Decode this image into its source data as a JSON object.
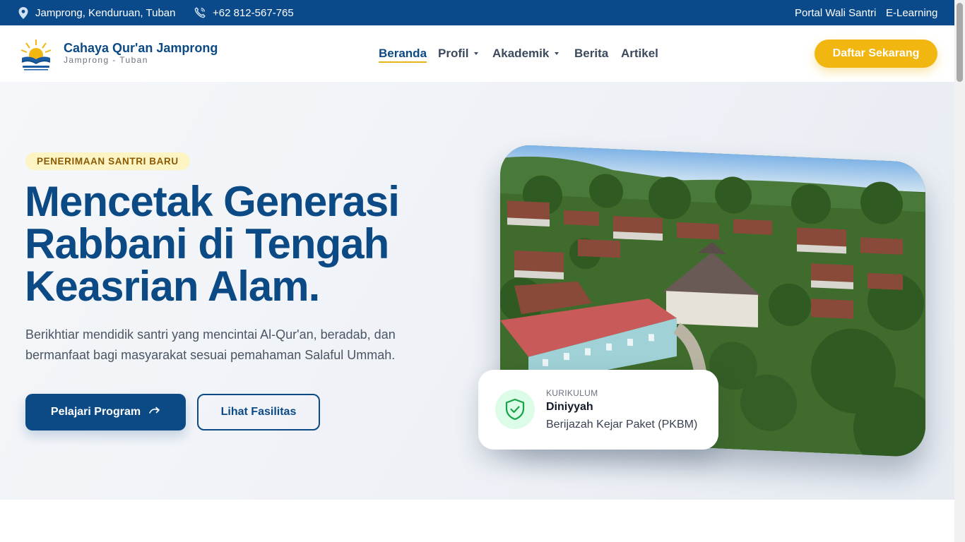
{
  "topbar": {
    "location": "Jamprong, Kenduruan, Tuban",
    "phone": "+62 812-567-765",
    "portal": "Portal Wali Santri",
    "elearning": "E-Learning"
  },
  "brand": {
    "name": "Cahaya Qur'an Jamprong",
    "sub": "Jamprong - Tuban"
  },
  "nav": {
    "items": [
      "Beranda",
      "Profil",
      "Akademik",
      "Berita",
      "Artikel"
    ],
    "active": "Beranda"
  },
  "cta_label": "Daftar Sekarang",
  "hero": {
    "badge": "PENERIMAAN SANTRI BARU",
    "headline_lines": [
      "Mencetak Generasi",
      "Rabbani di Tengah",
      "Keasrian Alam."
    ],
    "lead": "Berikhtiar mendidik santri yang mencintai Al-Qur'an, beradab, dan bermanfaat bagi masyarakat sesuai pemahaman Salaful Ummah.",
    "primary_button": "Pelajari Program",
    "secondary_button": "Lihat Fasilitas"
  },
  "card": {
    "label": "KURIKULUM",
    "title": "Diniyyah",
    "subtitle": "Berijazah Kejar Paket (PKBM)"
  },
  "colors": {
    "primary": "#0b4a85",
    "accent": "#f2b610",
    "topbar": "#0a4a8a"
  },
  "icons": {
    "location": "location-pin-icon",
    "phone": "phone-icon",
    "arrow": "arrow-right-icon",
    "shield": "shield-check-icon"
  }
}
